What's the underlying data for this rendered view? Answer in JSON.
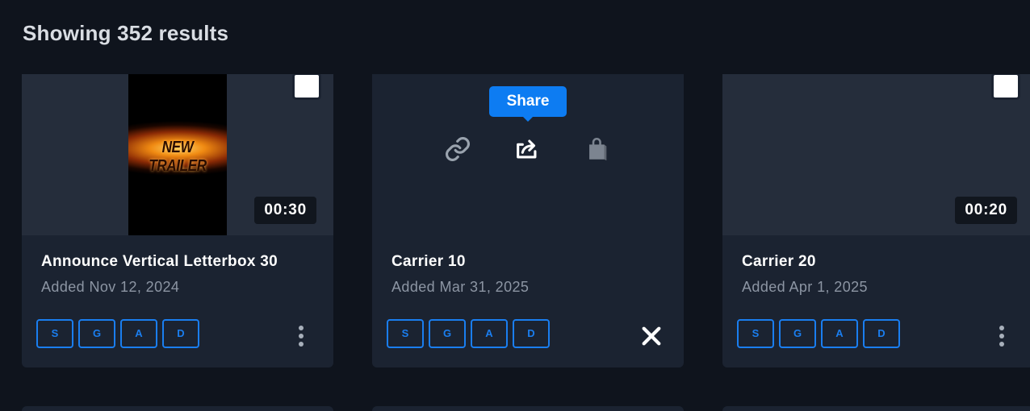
{
  "results_heading": "Showing 352 results",
  "colors": {
    "background": "#0f141d",
    "card": "#1b2331",
    "accent": "#0d7cf2",
    "tag_border": "#1a7ef0"
  },
  "cards": [
    {
      "poster_text": "NEW TRAILER",
      "duration": "00:30",
      "title": "Announce Vertical Letterbox 30",
      "added": "Added Nov 12, 2024",
      "tags": [
        "S",
        "G",
        "A",
        "D"
      ],
      "checkbox_icon": "checkbox-icon",
      "menu_icon": "more-vertical-icon"
    },
    {
      "title": "Carrier 10",
      "added": "Added Mar 31, 2025",
      "tags": [
        "S",
        "G",
        "A",
        "D"
      ],
      "tooltip": "Share",
      "hover_icons": [
        "link-icon",
        "share-icon",
        "shopping-bag-icon"
      ],
      "close_icon": "close-icon"
    },
    {
      "duration": "00:20",
      "title": "Carrier 20",
      "added": "Added Apr 1, 2025",
      "tags": [
        "S",
        "G",
        "A",
        "D"
      ],
      "checkbox_icon": "checkbox-icon",
      "menu_icon": "more-vertical-icon"
    }
  ]
}
